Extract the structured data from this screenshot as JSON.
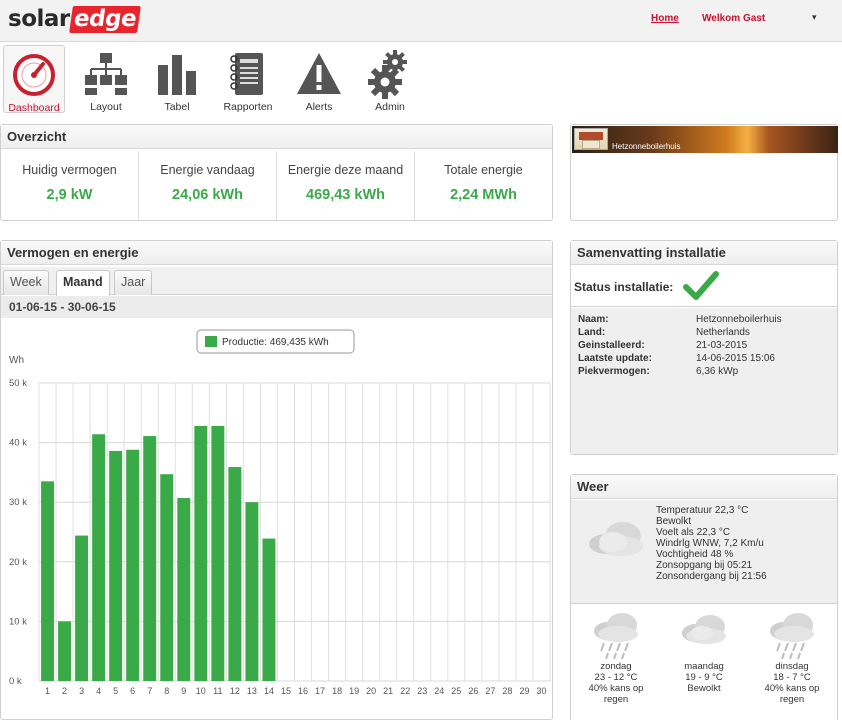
{
  "header": {
    "logo_solar": "solar",
    "logo_edge": "edge",
    "home_link": "Home",
    "welcome": "Welkom Gast",
    "user_caret": "▾"
  },
  "nav": {
    "items": [
      {
        "label": "Dashboard",
        "icon": "dashboard-gauge-icon",
        "active": true
      },
      {
        "label": "Layout",
        "icon": "layout-hierarchy-icon",
        "active": false
      },
      {
        "label": "Tabel",
        "icon": "bar-table-icon",
        "active": false
      },
      {
        "label": "Rapporten",
        "icon": "report-notebook-icon",
        "active": false
      },
      {
        "label": "Alerts",
        "icon": "alert-triangle-icon",
        "active": false
      },
      {
        "label": "Admin",
        "icon": "admin-gears-icon",
        "active": false
      }
    ]
  },
  "overview": {
    "title": "Overzicht",
    "cells": [
      {
        "label": "Huidig vermogen",
        "value": "2,9 kW"
      },
      {
        "label": "Energie vandaag",
        "value": "24,06 kWh"
      },
      {
        "label": "Energie deze maand",
        "value": "469,43 kWh"
      },
      {
        "label": "Totale energie",
        "value": "2,24 MWh"
      }
    ]
  },
  "site": {
    "name": "Hetzonneboilerhuis"
  },
  "energy": {
    "title": "Vermogen en energie",
    "tabs": [
      "Week",
      "Maand",
      "Jaar"
    ],
    "active_tab": "Maand",
    "date_range": "01-06-15 - 30-06-15"
  },
  "chart_data": {
    "type": "bar",
    "legend": "Productie: 469,435 kWh",
    "ylabel": "Wh",
    "ylim": [
      0,
      50000
    ],
    "yticks": [
      0,
      10000,
      20000,
      30000,
      40000,
      50000
    ],
    "ytick_labels": [
      "0 k",
      "10 k",
      "20 k",
      "30 k",
      "40 k",
      "50 k"
    ],
    "categories": [
      "1",
      "2",
      "3",
      "4",
      "5",
      "6",
      "7",
      "8",
      "9",
      "10",
      "11",
      "12",
      "13",
      "14",
      "15",
      "16",
      "17",
      "18",
      "19",
      "20",
      "21",
      "22",
      "23",
      "24",
      "25",
      "26",
      "27",
      "28",
      "29",
      "30"
    ],
    "values": [
      33500,
      10000,
      24400,
      41400,
      38600,
      38800,
      41100,
      34700,
      30700,
      42800,
      42800,
      35900,
      30000,
      23900,
      null,
      null,
      null,
      null,
      null,
      null,
      null,
      null,
      null,
      null,
      null,
      null,
      null,
      null,
      null,
      null
    ],
    "bar_color": "#3aaa48",
    "grid": true
  },
  "summary": {
    "title": "Samenvatting installatie",
    "status_label": "Status installatie:",
    "status_icon": "check-icon",
    "rows": [
      {
        "key": "Naam:",
        "value": "Hetzonneboilerhuis"
      },
      {
        "key": "Land:",
        "value": "Netherlands"
      },
      {
        "key": "Geinstalleerd:",
        "value": "21-03-2015"
      },
      {
        "key": "Laatste update:",
        "value": "14-06-2015 15:06"
      },
      {
        "key": "Piekvermogen:",
        "value": "6,36 kWp"
      }
    ]
  },
  "weather": {
    "title": "Weer",
    "now_icon": "cloud-icon",
    "lines": [
      "Temperatuur 22,3 °C",
      "Bewolkt",
      "Voelt als 22,3 °C",
      "Windrlg WNW, 7,2 Km/u",
      "Vochtigheid 48 %",
      "Zonsopgang bij 05:21",
      "Zonsondergang bij 21:56"
    ],
    "forecast": [
      {
        "day": "zondag",
        "temp": "23 - 12 °C",
        "desc1": "40% kans op",
        "desc2": "regen",
        "icon": "rain-cloud-icon"
      },
      {
        "day": "maandag",
        "temp": "19 - 9 °C",
        "desc1": "Bewolkt",
        "desc2": "",
        "icon": "cloud-icon"
      },
      {
        "day": "dinsdag",
        "temp": "18 - 7 °C",
        "desc1": "40% kans op",
        "desc2": "regen",
        "icon": "rain-cloud-icon"
      }
    ]
  }
}
